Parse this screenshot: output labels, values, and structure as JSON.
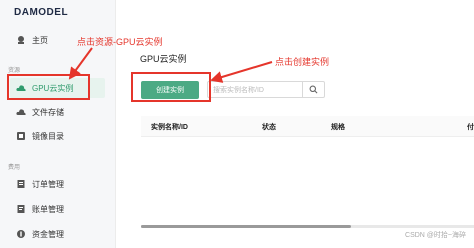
{
  "app": {
    "logo_text": "DAMODEL"
  },
  "sidebar": {
    "home_label": "主页",
    "section_resources": "资源",
    "items_resources": [
      {
        "label": "GPU云实例",
        "icon": "cloud-icon",
        "active": true
      },
      {
        "label": "文件存储",
        "icon": "storage-icon",
        "active": false
      },
      {
        "label": "镜像目录",
        "icon": "image-icon",
        "active": false
      }
    ],
    "section_cost": "费用",
    "items_cost": [
      {
        "label": "订单管理",
        "icon": "order-icon"
      },
      {
        "label": "账单管理",
        "icon": "bill-icon"
      },
      {
        "label": "资金管理",
        "icon": "fund-icon"
      }
    ]
  },
  "main": {
    "title": "GPU云实例",
    "create_button": "创建实例",
    "search_placeholder": "搜索实例名称/ID",
    "table_headers": [
      "实例名称/ID",
      "状态",
      "规格",
      "付"
    ]
  },
  "annotations": {
    "note1": "点击资源-GPU云实例",
    "note2": "点击创建实例"
  },
  "watermark": "CSDN @时拾~海碎",
  "colors": {
    "accent": "#4caa84",
    "annotation": "#e5352b"
  }
}
